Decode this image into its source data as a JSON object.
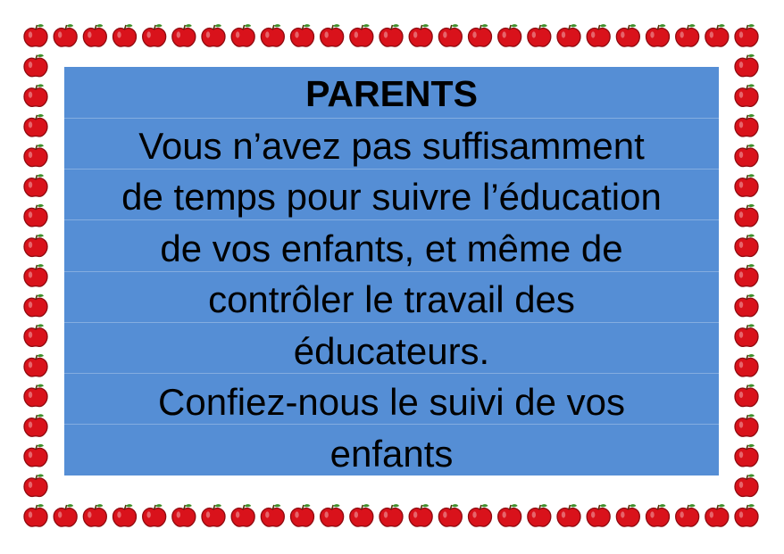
{
  "poster": {
    "title": "PARENTS",
    "body_lines": [
      "Vous n’avez pas suffisamment",
      "de temps pour suivre l’éducation",
      "de vos enfants, et même de",
      "contrôler le travail des",
      "éducateurs.",
      "Confiez-nous le suivi de vos",
      "enfants"
    ]
  },
  "colors": {
    "panel_background": "#558ed5",
    "text": "#000000",
    "apple_red": "#d9121b",
    "apple_dark": "#8e0a0f",
    "stem": "#5a2e0c",
    "leaf": "#3f8f2b"
  },
  "border": {
    "icon": "apple-icon"
  }
}
